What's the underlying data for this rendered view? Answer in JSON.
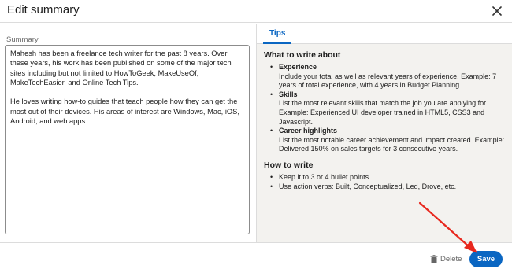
{
  "dialog": {
    "title": "Edit summary",
    "close_icon": "close-icon"
  },
  "summary": {
    "label": "Summary",
    "paragraph1": "Mahesh has been a freelance tech writer for the past 8 years. Over these years, his work has been published on some of the major tech sites including but not limited to HowToGeek, MakeUseOf, MakeTechEasier, and Online Tech Tips.",
    "paragraph2": "He loves writing how-to guides that teach people how they can get the most out of their devices. His areas of interest are Windows, Mac, iOS, Android, and web apps."
  },
  "tips": {
    "tab_label": "Tips",
    "section1_title": "What to write about",
    "items": [
      {
        "head": "Experience",
        "text": "Include your total as well as relevant years of experience. Example: 7 years of total experience, with 4 years in Budget Planning."
      },
      {
        "head": "Skills",
        "text": "List the most relevant skills that match the job you are applying for. Example: Experienced UI developer trained in HTML5, CSS3 and Javascript."
      },
      {
        "head": "Career highlights",
        "text": "List the most notable career achievement and impact created. Example: Delivered 150% on sales targets for 3 consecutive years."
      }
    ],
    "section2_title": "How to write",
    "how_items": [
      "Keep it to 3 or 4 bullet points",
      "Use action verbs: Built, Conceptualized, Led, Drove, etc."
    ]
  },
  "footer": {
    "delete_label": "Delete",
    "save_label": "Save",
    "trash_icon": "trash-icon"
  },
  "annotation": {
    "arrow_color": "#e8281e"
  },
  "colors": {
    "accent": "#0a66c2",
    "tips_background": "#f3f2ef"
  }
}
